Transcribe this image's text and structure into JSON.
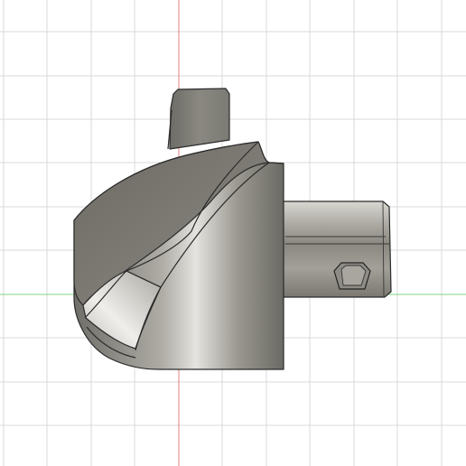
{
  "viewport": {
    "background": "#ffffff",
    "grid_color": "#d8d8d8",
    "x_axis_color": "#7fd77f",
    "y_axis_color": "#e77f7f",
    "model_base_color": "#8c8a82",
    "model_edge_color": "#2b2b2b"
  }
}
